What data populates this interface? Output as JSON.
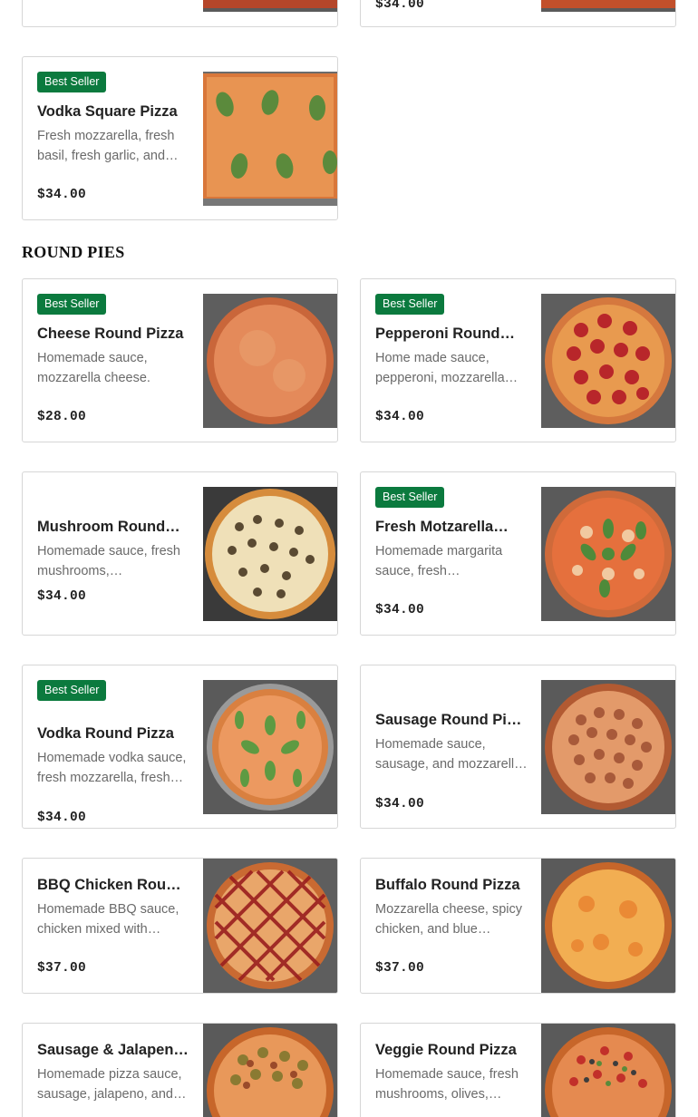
{
  "partial_top": {
    "left_card": {},
    "right_card": {
      "price": "$34.00"
    }
  },
  "square_card": {
    "badge": "Best Seller",
    "name": "Vodka Square Pizza",
    "desc": "Fresh mozzarella, fresh basil, fresh garlic, and…",
    "price": "$34.00",
    "image": "vodka-square-pizza-photo"
  },
  "section": {
    "title": "ROUND PIES"
  },
  "round_pies": [
    {
      "badge": "Best Seller",
      "name": "Cheese Round Pizza",
      "desc": "Homemade sauce, mozzarella cheese.",
      "price": "$28.00",
      "image": "cheese-pizza-photo"
    },
    {
      "badge": "Best Seller",
      "name": "Pepperoni Round…",
      "desc": "Home made sauce, pepperoni, mozzarella…",
      "price": "$34.00",
      "image": "pepperoni-pizza-photo"
    },
    {
      "badge": "",
      "name": "Mushroom Round…",
      "desc": "Homemade sauce, fresh mushrooms, mozzarella…",
      "price": "$34.00",
      "image": "mushroom-pizza-photo"
    },
    {
      "badge": "Best Seller",
      "name": "Fresh Motzarella…",
      "desc": "Homemade margarita sauce, fresh mozzarella,…",
      "price": "$34.00",
      "image": "margherita-pizza-photo"
    },
    {
      "badge": "Best Seller",
      "name": "Vodka Round Pizza",
      "desc": "Homemade vodka sauce, fresh mozzarella, fresh…",
      "price": "$34.00",
      "image": "vodka-round-pizza-photo"
    },
    {
      "badge": "",
      "name": "Sausage Round Pizza",
      "desc": "Homemade sauce, sausage, and mozzarell…",
      "price": "$34.00",
      "image": "sausage-pizza-photo"
    },
    {
      "badge": "",
      "name": "BBQ Chicken Round…",
      "desc": "Homemade BBQ sauce, chicken mixed with BBQ…",
      "price": "$37.00",
      "image": "bbq-chicken-pizza-photo"
    },
    {
      "badge": "",
      "name": "Buffalo Round Pizza",
      "desc": "Mozzarella cheese, spicy chicken, and blue chees…",
      "price": "$37.00",
      "image": "buffalo-pizza-photo"
    },
    {
      "badge": "",
      "name": "Sausage & Jalapeno…",
      "desc": "Homemade pizza sauce, sausage, jalapeno, and…",
      "price": "",
      "image": "sausage-jalapeno-pizza-photo"
    },
    {
      "badge": "",
      "name": "Veggie Round Pizza",
      "desc": "Homemade sauce, fresh mushrooms, olives,…",
      "price": "",
      "image": "veggie-pizza-photo"
    }
  ]
}
